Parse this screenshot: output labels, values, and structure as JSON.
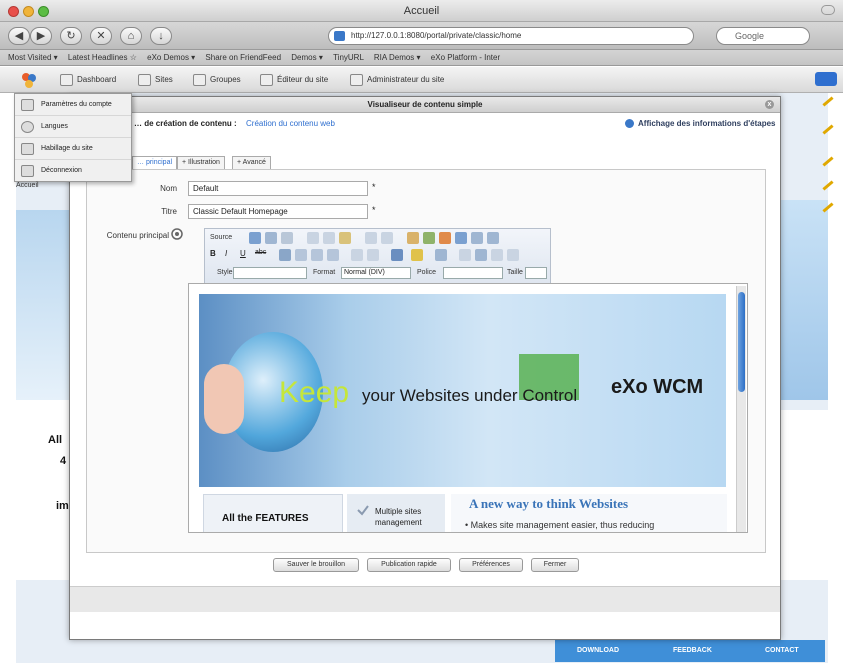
{
  "window": {
    "title": "Accueil"
  },
  "browser": {
    "url": "http://127.0.0.1:8080/portal/private/classic/home",
    "search_placeholder": "Google",
    "bookmarks": [
      "Most Visited ▾",
      "Latest Headlines ☆",
      "eXo Demos ▾",
      "Share on FriendFeed",
      "Demos ▾",
      "TinyURL",
      "RIA Demos ▾",
      "eXo Platform - Inter"
    ]
  },
  "adminbar": {
    "items": [
      "Dashboard",
      "Sites",
      "Groupes",
      "Éditeur du site",
      "Administrateur du site"
    ]
  },
  "dropdown": {
    "items": [
      "Paramètres du compte",
      "Langues",
      "Habillage du site",
      "Déconnexion"
    ],
    "accueil": "Accueil"
  },
  "modal": {
    "title": "Visualiseur de contenu simple",
    "close": "x",
    "step1_prefix": "… de création de contenu :",
    "step1_link": "Création du contenu web",
    "step2": "Affichage des informations d'étapes",
    "tabs": [
      "… principal",
      "+ Illustration",
      "+ Avancé"
    ],
    "form": {
      "name_label": "Nom",
      "name_value": "Default",
      "title_label": "Titre",
      "title_value": "Classic Default Homepage",
      "content_label": "Contenu principal",
      "required": "*"
    },
    "editor": {
      "source_label": "Source",
      "style_label": "Style",
      "format_label": "Format",
      "format_value": "Normal (DIV)",
      "font_label": "Police",
      "size_label": "Taille"
    },
    "content": {
      "keep": "Keep",
      "tagline": "your Websites under Control",
      "brand": "eXo WCM",
      "features_title": "All the FEATURES",
      "feature_item": "Multiple sites management",
      "promo_heading": "A new way to think Websites",
      "promo_text": "• Makes site management easier, thus reducing"
    },
    "actions": [
      "Sauver le brouillon",
      "Publication rapide",
      "Préférences",
      "Fermer"
    ]
  },
  "background": {
    "fragments": [
      "All",
      "im",
      "4"
    ],
    "footer": [
      "DOWNLOAD",
      "FEEDBACK",
      "CONTACT"
    ]
  }
}
